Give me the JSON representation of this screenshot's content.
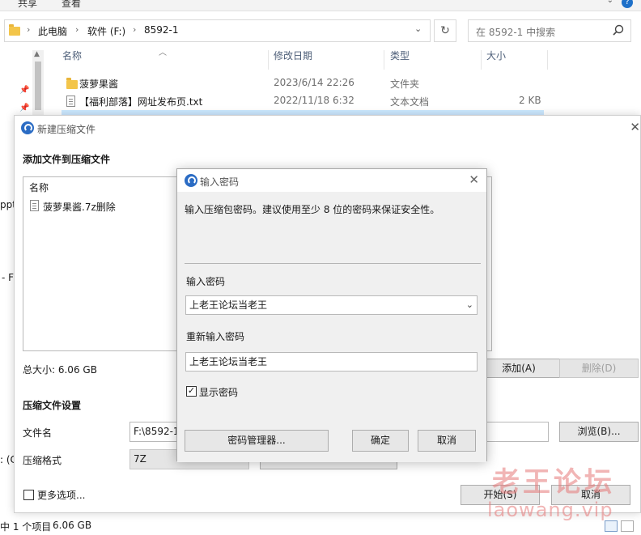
{
  "ribbon": {
    "tab_share": "共享",
    "tab_view": "查看"
  },
  "address": {
    "crumbs": [
      "此电脑",
      "软件 (F:)",
      "8592-1"
    ],
    "search_placeholder": "在 8592-1 中搜索"
  },
  "columns": {
    "name": "名称",
    "modified": "修改日期",
    "type": "类型",
    "size": "大小"
  },
  "files": [
    {
      "name": "菠萝果酱",
      "modified": "2023/6/14 22:26",
      "type": "文件夹",
      "size": ""
    },
    {
      "name": "【福利部落】网址发布页.txt",
      "modified": "2022/11/18 6:32",
      "type": "文本文档",
      "size": "2 KB"
    }
  ],
  "left_fragments": {
    "ppt": "ppt",
    "pr": "- F",
    "oc": ": (C"
  },
  "status": {
    "count": "中 1 个项目",
    "size": "6.06 GB"
  },
  "archive_dialog": {
    "title": "新建压缩文件",
    "section_add": "添加文件到压缩文件",
    "list_header": "名称",
    "list_items": [
      "菠萝果酱.7z删除"
    ],
    "total_size": "总大小: 6.06 GB",
    "btn_add": "添加(A)",
    "btn_delete": "删除(D)",
    "section_settings": "压缩文件设置",
    "label_filename": "文件名",
    "filename_value": "F:\\8592-1",
    "btn_browse": "浏览(B)...",
    "label_format": "压缩格式",
    "format_value": "7Z",
    "more_options": "更多选项...",
    "btn_start": "开始(S)",
    "btn_cancel": "取消"
  },
  "password_dialog": {
    "title": "输入密码",
    "instruction": "输入压缩包密码。建议使用至少 8 位的密码来保证安全性。",
    "label_password": "输入密码",
    "password_value": "上老王论坛当老王",
    "label_confirm": "重新输入密码",
    "confirm_value": "上老王论坛当老王",
    "show_password_label": "显示密码",
    "show_password_checked": true,
    "btn_manager": "密码管理器...",
    "btn_ok": "确定",
    "btn_cancel": "取消"
  },
  "watermark": {
    "line1": "老王论坛",
    "line2": "laowang.vip"
  },
  "colors": {
    "accent": "#2b6cc4",
    "selection": "#cce8ff",
    "folder": "#f3c54a"
  }
}
